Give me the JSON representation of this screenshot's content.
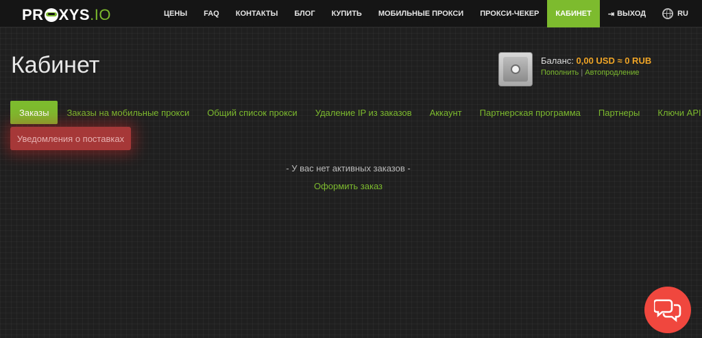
{
  "header": {
    "logo_main": "PR",
    "logo_rest": "XYS",
    "logo_io": ".IO",
    "nav": [
      {
        "label": "ЦЕНЫ",
        "name": "nav-prices"
      },
      {
        "label": "FAQ",
        "name": "nav-faq"
      },
      {
        "label": "КОНТАКТЫ",
        "name": "nav-contacts"
      },
      {
        "label": "БЛОГ",
        "name": "nav-blog"
      },
      {
        "label": "КУПИТЬ",
        "name": "nav-buy"
      },
      {
        "label": "МОБИЛЬНЫЕ ПРОКСИ",
        "name": "nav-mobile-proxy"
      },
      {
        "label": "ПРОКСИ-ЧЕКЕР",
        "name": "nav-proxy-checker"
      },
      {
        "label": "КАБИНЕТ",
        "name": "nav-cabinet",
        "active": true
      }
    ],
    "logout_label": "ВЫХОД",
    "language": "RU"
  },
  "page": {
    "title": "Кабинет"
  },
  "balance": {
    "label": "Баланс:",
    "amount": "0,00 USD ≈ 0 RUB",
    "topup_label": "Пополнить",
    "separator": "|",
    "autorenew_label": "Автопродление"
  },
  "tabs": [
    {
      "label": "Заказы",
      "active": true
    },
    {
      "label": "Заказы на мобильные прокси"
    },
    {
      "label": "Общий список прокси"
    },
    {
      "label": "Удаление IP из заказов"
    },
    {
      "label": "Аккаунт"
    },
    {
      "label": "Партнерская программа"
    },
    {
      "label": "Партнеры"
    },
    {
      "label": "Ключи API"
    }
  ],
  "notifications_button": "Уведомления о поставках",
  "empty_state": {
    "message": "- У вас нет активных заказов -",
    "order_link": "Оформить заказ"
  },
  "colors": {
    "accent": "#7dbb2e",
    "balance_amount": "#f0a526",
    "notify_bg": "#a63838",
    "chat_bg": "#f0473e"
  }
}
